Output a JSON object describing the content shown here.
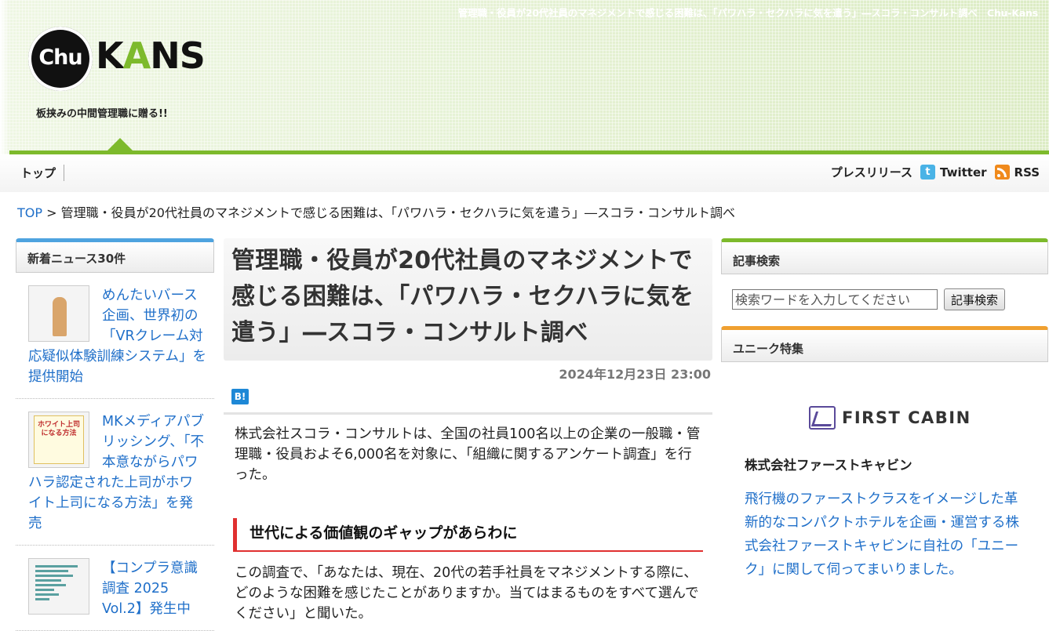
{
  "header": {
    "page_title": "管理職・役員が20代社員のマネジメントで感じる困難は、「パワハラ・セクハラに気を遣う」―スコラ・コンサルト調べ　Chu-Kans",
    "logo_chu": "Chu",
    "logo_kans_1": "K",
    "logo_kans_a": "A",
    "logo_kans_2": "NS",
    "tagline": "板挟みの中間管理職に贈る!!"
  },
  "nav": {
    "top": "トップ",
    "press": "プレスリリース",
    "twitter": "Twitter",
    "rss": "RSS"
  },
  "breadcrumb": {
    "top": "TOP",
    "sep": " > ",
    "current": "管理職・役員が20代社員のマネジメントで感じる困難は、「パワハラ・セクハラに気を遣う」―スコラ・コンサルト調べ"
  },
  "left": {
    "heading": "新着ニュース30件",
    "items": [
      {
        "title": "めんたいバース企画、世界初の「VRクレーム対応疑似体験訓練システム」を提供開始"
      },
      {
        "title": "MKメディアパブリッシング、「不本意ながらパワハラ認定された上司がホワイト上司になる方法」を発売",
        "thumb_text": "ホワイト上司になる方法"
      },
      {
        "title": "【コンプラ意識調査 2025 Vol.2】発生中"
      }
    ]
  },
  "article": {
    "title": "管理職・役員が20代社員のマネジメントで感じる困難は、「パワハラ・セクハラに気を遣う」―スコラ・コンサルト調べ",
    "date": "2024年12月23日 23:00",
    "hatebu": "B!",
    "lead": "株式会社スコラ・コンサルトは、全国の社員100名以上の企業の一般職・管理職・役員およそ6,000名を対象に、「組織に関するアンケート調査」を行った。",
    "h2": "世代による価値観のギャップがあらわに",
    "body": "この調査で、「あなたは、現在、20代の若手社員をマネジメントする際に、どのような困難を感じたことがありますか。当てはまるものをすべて選んでください」と聞いた。"
  },
  "right": {
    "search_heading": "記事検索",
    "search_placeholder": "検索ワードを入力してください",
    "search_button": "記事検索",
    "feature_heading": "ユニーク特集",
    "brand": "FIRST CABIN",
    "company": "株式会社ファーストキャビン",
    "description": "飛行機のファーストクラスをイメージした革新的なコンパクトホテルを企画・運営する株式会社ファーストキャビンに自社の「ユニーク」に関して伺ってまいりました。"
  },
  "colors": {
    "accent_green": "#7dba2c",
    "link_blue": "#1f6fc9",
    "heading_red": "#e03030"
  }
}
